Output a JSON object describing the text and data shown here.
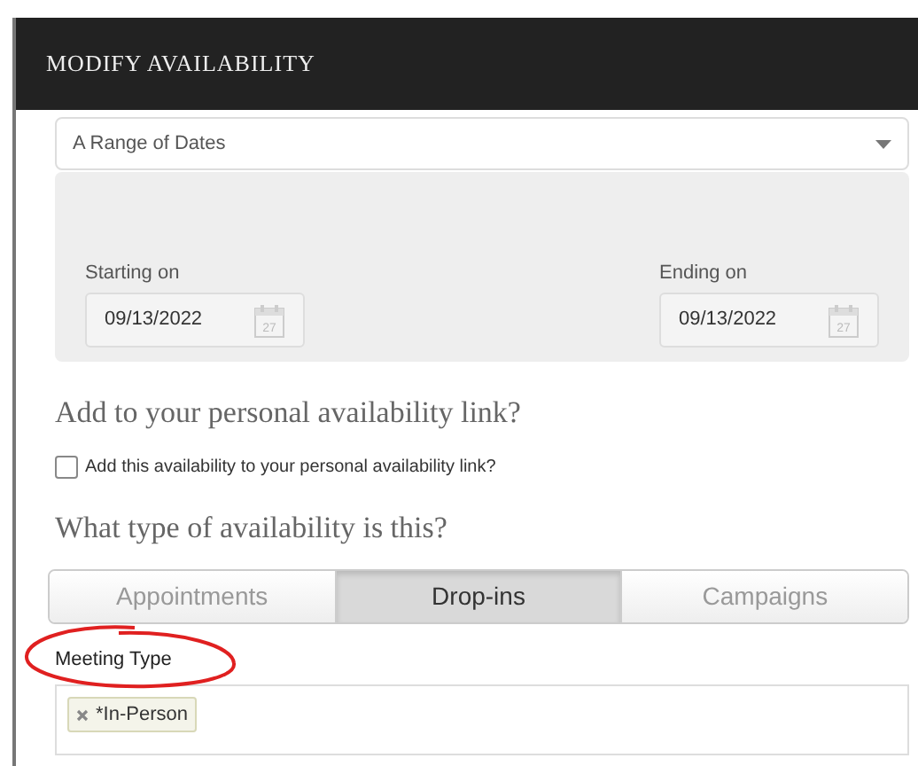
{
  "dialog": {
    "title": "MODIFY AVAILABILITY"
  },
  "date_mode": {
    "value": "A Range of Dates"
  },
  "start_date": {
    "label": "Starting on",
    "value": "09/13/2022",
    "calendar_day": "27"
  },
  "end_date": {
    "label": "Ending on",
    "value": "09/13/2022",
    "calendar_day": "27"
  },
  "personal_link": {
    "heading": "Add to your personal availability link?",
    "checkbox_label": "Add this availability to your personal availability link?",
    "checked": false
  },
  "availability_type": {
    "heading": "What type of availability is this?",
    "tabs": [
      {
        "label": "Appointments",
        "selected": false
      },
      {
        "label": "Drop-ins",
        "selected": true
      },
      {
        "label": "Campaigns",
        "selected": false
      }
    ]
  },
  "meeting_type": {
    "label": "Meeting Type",
    "tags": [
      {
        "label": "*In-Person"
      }
    ]
  }
}
